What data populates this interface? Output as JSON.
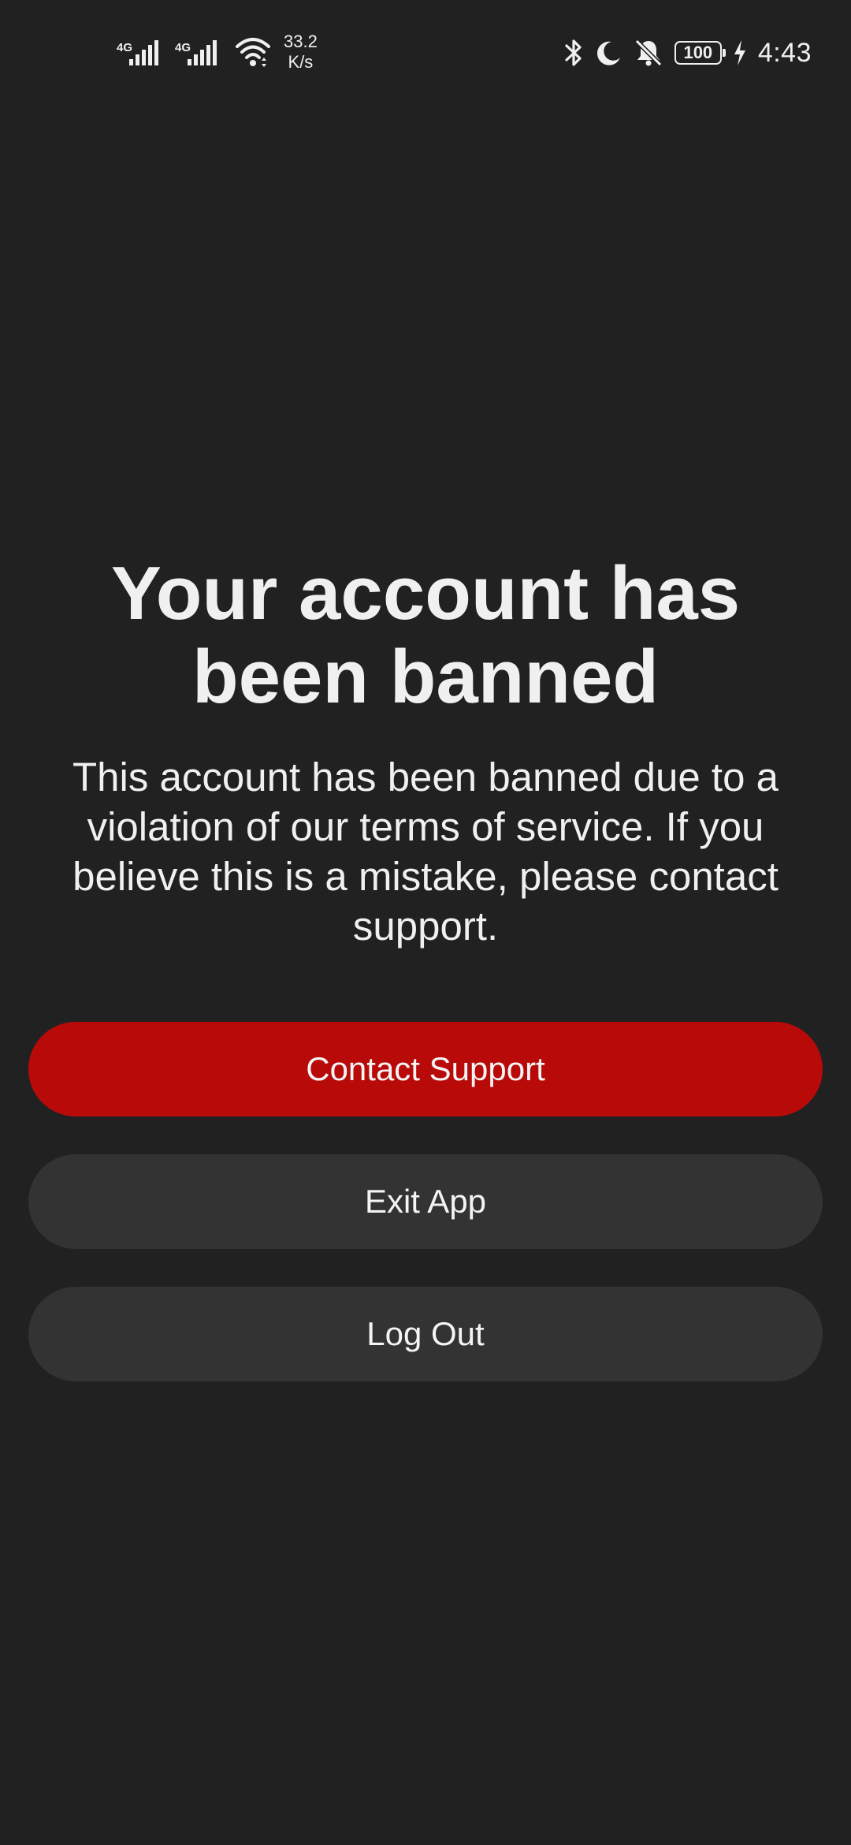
{
  "status_bar": {
    "sim1_network": "4G",
    "sim2_network": "4G",
    "network_speed_value": "33.2",
    "network_speed_unit": "K/s",
    "battery_level": "100",
    "time": "4:43",
    "icons": [
      "signal-icon",
      "wifi-icon",
      "bluetooth-icon",
      "moon-icon",
      "bell-off-icon",
      "battery-icon",
      "charging-icon"
    ]
  },
  "ban_screen": {
    "title": "Your account has been banned",
    "message": "This account has been banned due to a violation of our terms of service. If you believe this is a mistake, please contact support.",
    "contact_support_label": "Contact Support",
    "exit_app_label": "Exit App",
    "log_out_label": "Log Out"
  },
  "colors": {
    "background": "#212121",
    "primary_button": "#b90a0a",
    "secondary_button": "#333333",
    "text": "#f0f0f0"
  }
}
